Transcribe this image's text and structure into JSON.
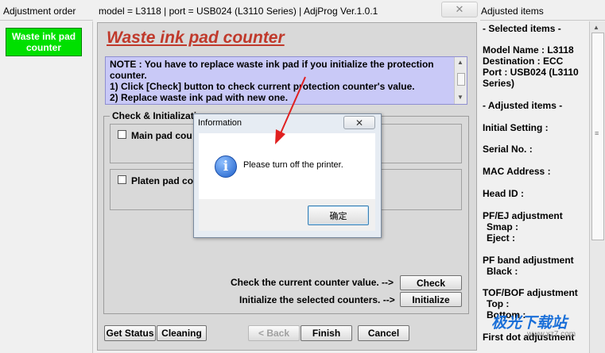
{
  "left_pane": {
    "title": "Adjustment order",
    "item": "Waste ink pad counter"
  },
  "main_window": {
    "title": "model = L3118 | port = USB024 (L3110 Series) | AdjProg Ver.1.0.1",
    "heading": "Waste ink pad counter",
    "note_lines": [
      "NOTE : You have to replace waste ink pad if you initialize the protection",
      "counter.",
      "1) Click [Check] button to check current protection counter's value.",
      "2) Replace waste ink pad with new one."
    ],
    "group_label": "Check & Initializati",
    "main_pad_label": "Main pad cou",
    "platen_pad_label": "Platen pad co",
    "check_text": "Check the current counter value. -->",
    "init_text": "Initialize the selected counters. -->",
    "check_button": "Check",
    "initialize_button": "Initialize",
    "get_status_button": "Get Status",
    "cleaning_button": "Cleaning",
    "back_button": "< Back",
    "finish_button": "Finish",
    "cancel_button": "Cancel"
  },
  "dialog": {
    "title": "Information",
    "message": "Please turn off the printer.",
    "ok_button": "确定"
  },
  "right_pane": {
    "title": "Adjusted items",
    "selected_header": "- Selected items -",
    "model": "Model Name : L3118",
    "destination": "Destination : ECC",
    "port_line1": "Port : USB024 (L3110",
    "port_line2": "Series)",
    "adjusted_header": "- Adjusted items -",
    "initial_setting": "Initial Setting :",
    "serial_no": "Serial No. :",
    "mac": "MAC Address :",
    "head_id": "Head ID :",
    "pfej": "PF/EJ adjustment",
    "smap": "Smap :",
    "eject": "Eject :",
    "pfband": "PF band adjustment",
    "black": "Black :",
    "tofbof": "TOF/BOF adjustment",
    "top": "Top :",
    "bottom": "Bottom :",
    "first_dot": "First dot adjustment"
  },
  "watermark": {
    "text": "极光下载站",
    "url": "www.xz7.com"
  },
  "colors": {
    "heading": "#c0392b",
    "note_bg": "#c9c9f7",
    "active_item": "#00e000",
    "arrow": "#e02020"
  }
}
